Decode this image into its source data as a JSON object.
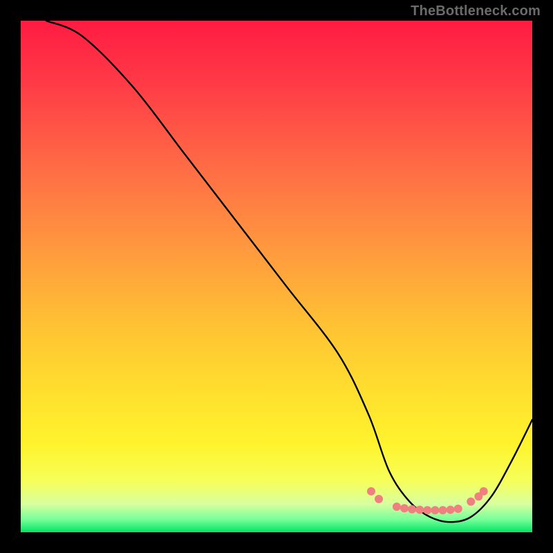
{
  "watermark": "TheBottleneck.com",
  "chart_data": {
    "type": "line",
    "title": "",
    "xlabel": "",
    "ylabel": "",
    "xlim": [
      0,
      100
    ],
    "ylim": [
      0,
      100
    ],
    "grid": false,
    "series": [
      {
        "name": "curve",
        "color": "#000000",
        "x": [
          5,
          12,
          22,
          32,
          42,
          52,
          62,
          68,
          72,
          76,
          80,
          84,
          88,
          92,
          96,
          100
        ],
        "y": [
          100,
          97,
          87,
          74,
          61,
          48,
          35,
          23,
          12,
          6,
          3,
          2,
          3,
          7,
          14,
          22
        ]
      }
    ],
    "highlight_points": {
      "color": "#f08080",
      "points": [
        [
          68.5,
          8.0
        ],
        [
          70.0,
          6.5
        ],
        [
          73.5,
          5.0
        ],
        [
          75.0,
          4.7
        ],
        [
          76.5,
          4.5
        ],
        [
          78.0,
          4.4
        ],
        [
          79.5,
          4.3
        ],
        [
          81.0,
          4.3
        ],
        [
          82.5,
          4.3
        ],
        [
          84.0,
          4.4
        ],
        [
          85.5,
          4.6
        ],
        [
          88.0,
          6.0
        ],
        [
          89.5,
          7.0
        ],
        [
          90.5,
          8.0
        ]
      ]
    },
    "gradient_stops": [
      {
        "offset": 0.0,
        "color": "#ff1b42"
      },
      {
        "offset": 0.12,
        "color": "#ff3a46"
      },
      {
        "offset": 0.28,
        "color": "#ff6a45"
      },
      {
        "offset": 0.45,
        "color": "#ff9a3e"
      },
      {
        "offset": 0.6,
        "color": "#ffc333"
      },
      {
        "offset": 0.73,
        "color": "#ffe02e"
      },
      {
        "offset": 0.83,
        "color": "#fff42d"
      },
      {
        "offset": 0.9,
        "color": "#f6ff5a"
      },
      {
        "offset": 0.945,
        "color": "#d8ffa0"
      },
      {
        "offset": 0.975,
        "color": "#76ff9a"
      },
      {
        "offset": 1.0,
        "color": "#00e565"
      }
    ]
  }
}
